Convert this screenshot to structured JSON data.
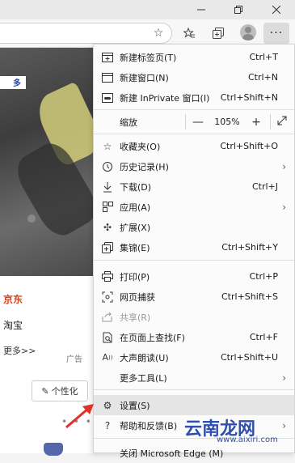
{
  "toolbar": {
    "icons": [
      "favorite-star-icon",
      "favorites-icon",
      "collections-icon",
      "profile-icon",
      "more-icon"
    ]
  },
  "window": {
    "controls": [
      "minimize",
      "restore",
      "close"
    ]
  },
  "page": {
    "pill_text": "多",
    "jd": "京东",
    "taobao": "淘宝",
    "more": "更多>>",
    "ad": "广告",
    "personalize": "个性化",
    "dots": "• • •"
  },
  "menu": {
    "items": [
      {
        "icon": "new-tab-icon",
        "label": "新建标签页(T)",
        "shortcut": "Ctrl+T"
      },
      {
        "icon": "new-window-icon",
        "label": "新建窗口(N)",
        "shortcut": "Ctrl+N"
      },
      {
        "icon": "inprivate-icon",
        "label": "新建 InPrivate 窗口(I)",
        "shortcut": "Ctrl+Shift+N"
      },
      {
        "icon": "favorites-icon",
        "label": "收藏夹(O)",
        "shortcut": "Ctrl+Shift+O"
      },
      {
        "icon": "history-icon",
        "label": "历史记录(H)",
        "shortcut": ""
      },
      {
        "icon": "download-icon",
        "label": "下载(D)",
        "shortcut": "Ctrl+J"
      },
      {
        "icon": "apps-icon",
        "label": "应用(A)",
        "shortcut": ""
      },
      {
        "icon": "extensions-icon",
        "label": "扩展(X)",
        "shortcut": ""
      },
      {
        "icon": "collections-icon",
        "label": "集锦(E)",
        "shortcut": "Ctrl+Shift+Y"
      },
      {
        "icon": "print-icon",
        "label": "打印(P)",
        "shortcut": "Ctrl+P"
      },
      {
        "icon": "web-capture-icon",
        "label": "网页捕获",
        "shortcut": "Ctrl+Shift+S"
      },
      {
        "icon": "share-icon",
        "label": "共享(R)",
        "shortcut": ""
      },
      {
        "icon": "find-icon",
        "label": "在页面上查找(F)",
        "shortcut": "Ctrl+F"
      },
      {
        "icon": "read-aloud-icon",
        "label": "大声朗读(U)",
        "shortcut": "Ctrl+Shift+U"
      },
      {
        "icon": "",
        "label": "更多工具(L)",
        "shortcut": ""
      },
      {
        "icon": "settings-icon",
        "label": "设置(S)",
        "shortcut": ""
      },
      {
        "icon": "help-icon",
        "label": "帮助和反馈(B)",
        "shortcut": ""
      },
      {
        "icon": "",
        "label": "关闭 Microsoft Edge (M)",
        "shortcut": ""
      }
    ],
    "zoom": {
      "label": "缩放",
      "minus": "—",
      "value": "105%",
      "plus": "+"
    }
  },
  "watermark": {
    "text": "云南龙网",
    "url": "www.aixiri.com"
  },
  "colors": {
    "menu_bg": "#fbfbfb",
    "highlight": "#e5e5e5",
    "accent_red": "#e0302a",
    "watermark": "#2e4fb0"
  }
}
